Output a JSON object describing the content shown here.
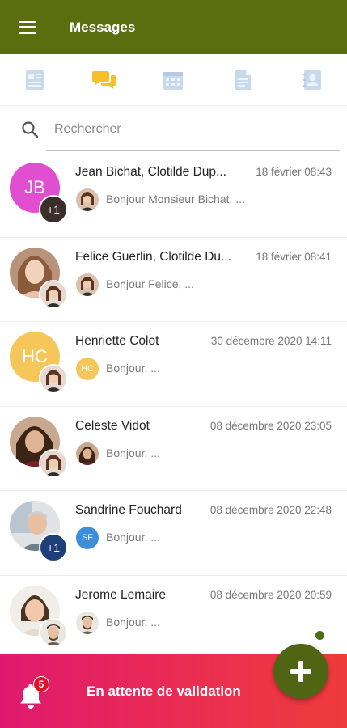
{
  "app": {
    "title": "Messages"
  },
  "colors": {
    "appbar": "#5a6e10",
    "accent": "#f5c02a",
    "unread": "#4d6d1a",
    "bottom_gradient_start": "#e0196e",
    "bottom_gradient_end": "#ef3b3b",
    "fab": "#4f6513"
  },
  "tabs": [
    {
      "icon": "news-icon",
      "active": false
    },
    {
      "icon": "chat-icon",
      "active": true
    },
    {
      "icon": "calendar-icon",
      "active": false
    },
    {
      "icon": "document-icon",
      "active": false
    },
    {
      "icon": "contacts-icon",
      "active": false
    }
  ],
  "search": {
    "placeholder": "Rechercher"
  },
  "conversations": [
    {
      "name": "Jean Bichat, Clotilde Dup...",
      "date": "18 février 08:43",
      "avatar_initials": "JB",
      "sub_avatar_text": "+1",
      "preview": "Bonjour Monsieur Bichat, ...",
      "mini_initials": ""
    },
    {
      "name": "Felice Guerlin, Clotilde Du...",
      "date": "18 février 08:41",
      "avatar_initials": "",
      "sub_avatar_text": "",
      "preview": "Bonjour Felice, ...",
      "mini_initials": ""
    },
    {
      "name": "Henriette Colot",
      "date": "30 décembre 2020 14:11",
      "avatar_initials": "HC",
      "sub_avatar_text": "",
      "preview": "Bonjour, ...",
      "mini_initials": "HC"
    },
    {
      "name": "Celeste Vidot",
      "date": "08 décembre 2020 23:05",
      "avatar_initials": "",
      "sub_avatar_text": "",
      "preview": "Bonjour, ...",
      "mini_initials": ""
    },
    {
      "name": "Sandrine Fouchard",
      "date": "08 décembre 2020 22:48",
      "avatar_initials": "",
      "sub_avatar_text": "+1",
      "preview": "Bonjour, ...",
      "mini_initials": "SF"
    },
    {
      "name": "Jerome Lemaire",
      "date": "08 décembre 2020 20:59",
      "avatar_initials": "",
      "sub_avatar_text": "",
      "preview": "Bonjour, ...",
      "mini_initials": ""
    }
  ],
  "bottom": {
    "label": "En attente de validation",
    "badge_count": "5"
  }
}
